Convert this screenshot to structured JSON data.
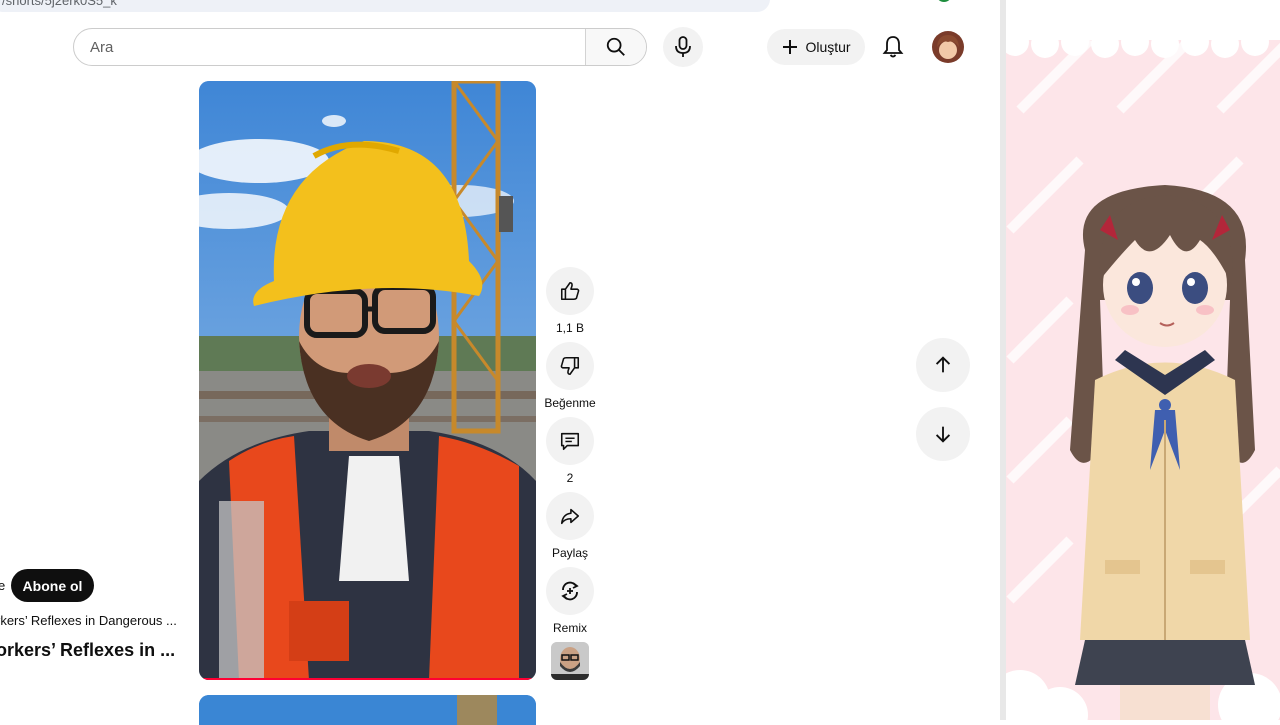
{
  "browser": {
    "url_fragment": "/shorts/5j2erk0S5_k",
    "profile_icon": "profile-dot-icon",
    "colors": {
      "bar": "#eef1f7"
    }
  },
  "header": {
    "search_placeholder": "Ara",
    "create_label": "Oluştur",
    "icons": [
      "search-icon",
      "mic-icon",
      "plus-icon",
      "bell-icon",
      "avatar"
    ]
  },
  "short": {
    "channel_name_tail": "e",
    "subscribe_label": "Abone ol",
    "subtitle": "rkers’ Reflexes in Dangerous ...",
    "title": "orkers’ Reflexes in ...",
    "actions": {
      "like_count": "1,1 B",
      "dislike_label": "Beğenme",
      "comment_count": "2",
      "share_label": "Paylaş",
      "remix_label": "Remix"
    }
  },
  "nav": {
    "up": "arrow-up-icon",
    "down": "arrow-down-icon"
  },
  "colors": {
    "accent": "#ff0033",
    "subscribe_bg": "#0f0f0f",
    "button_bg": "#f2f2f2",
    "panel_pink": "#fde7ea"
  }
}
